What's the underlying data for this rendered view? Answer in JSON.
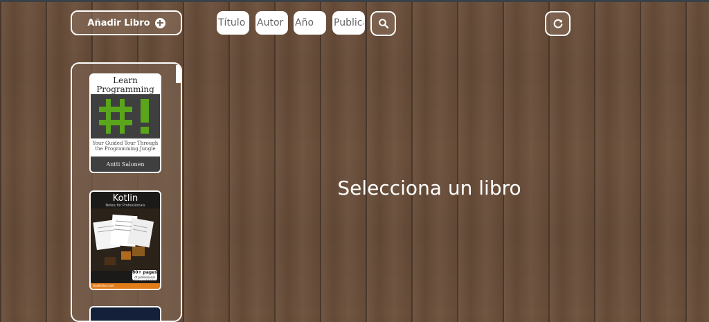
{
  "toolbar": {
    "add_label": "Añadir Libro",
    "titulo_placeholder": "Título",
    "autor_placeholder": "Autor",
    "anio_placeholder": "Año",
    "publicacion_placeholder": "Publicación"
  },
  "books": [
    {
      "title_line1": "Learn",
      "title_line2": "Programming",
      "subtitle": "Your Guided Tour Through the Programming Jungle",
      "author": "Antti Salonen"
    },
    {
      "title": "Kotlin",
      "subtitle": "Notes for Professionals",
      "badge": "80+ pages",
      "badge_sub": "of professional hints and tricks",
      "footer": "GoalKicker.com"
    },
    {}
  ],
  "main": {
    "empty_message": "Selecciona un libro"
  },
  "colors": {
    "wood": "#6b4f3a",
    "accent_green": "#5aa51b",
    "kotlin_orange": "#e07c1a"
  }
}
